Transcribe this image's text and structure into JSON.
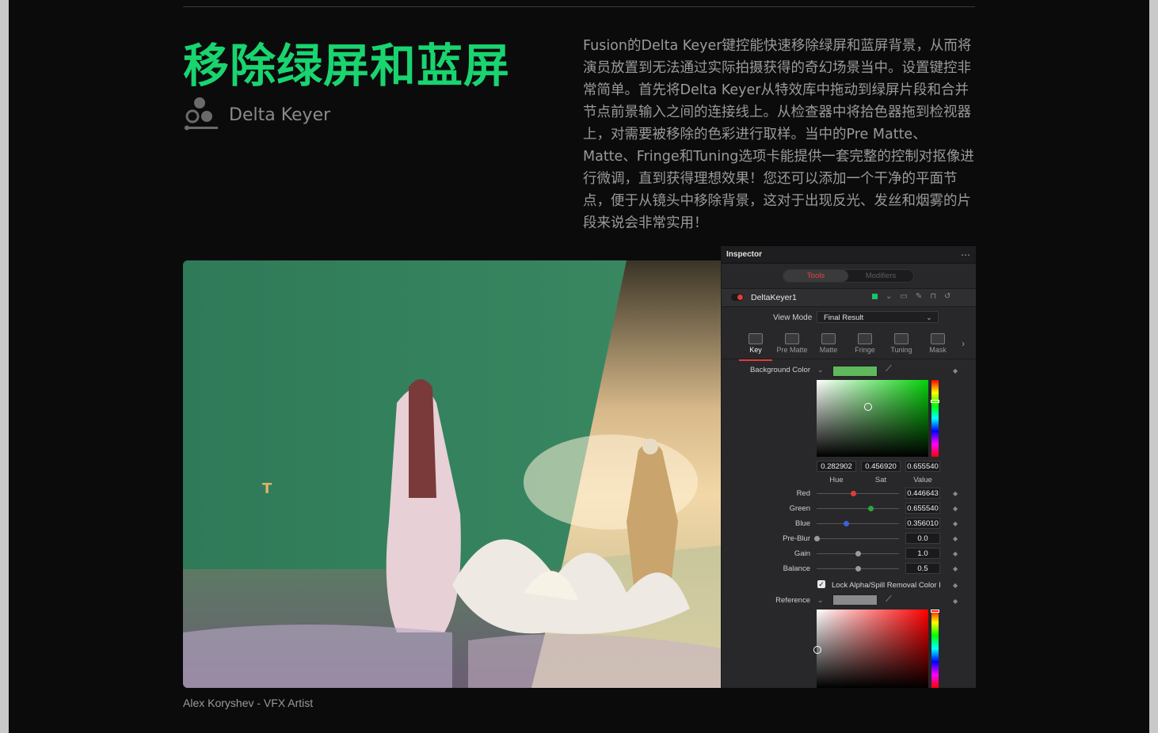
{
  "heading": "移除绿屏和蓝屏",
  "tool": {
    "name": "Delta Keyer",
    "icon": "delta-keyer-icon"
  },
  "description": "Fusion的Delta Keyer键控能快速移除绿屏和蓝屏背景，从而将演员放置到无法通过实际拍摄获得的奇幻场景当中。设置键控非常简单。首先将Delta Keyer从特效库中拖动到绿屏片段和合并节点前景输入之间的连接线上。从检查器中将拾色器拖到检视器上，对需要被移除的色彩进行取样。当中的Pre Matte、Matte、Fringe和Tuning选项卡能提供一套完整的控制对抠像进行微调，直到获得理想效果！您还可以添加一个干净的平面节点，便于从镜头中移除背景，这对于出现反光、发丝和烟雾的片段来说会非常实用！",
  "credit": "Alex Koryshev - VFX Artist",
  "colors": {
    "accent": "#19d46f",
    "keyer_bg_color": "#5fb85b",
    "tab_active": "#e23b3b"
  },
  "inspector": {
    "title": "Inspector",
    "more": "⋯",
    "segments": {
      "tools": "Tools",
      "modifiers": "Modifiers"
    },
    "node_name": "DeltaKeyer1",
    "view_mode": {
      "label": "View Mode",
      "value": "Final Result"
    },
    "tabs": [
      "Key",
      "Pre Matte",
      "Matte",
      "Fringe",
      "Tuning",
      "Mask"
    ],
    "active_tab": "Key",
    "background_color_label": "Background Color",
    "hsv": {
      "hue": "0.282902",
      "sat": "0.456920",
      "value": "0.655540"
    },
    "hsv_labels": {
      "hue": "Hue",
      "sat": "Sat",
      "value": "Value"
    },
    "params": [
      {
        "label": "Red",
        "value": "0.446643",
        "level": 0.446643,
        "color": "#e23b3b"
      },
      {
        "label": "Green",
        "value": "0.655540",
        "level": 0.65554,
        "color": "#2aa83a"
      },
      {
        "label": "Blue",
        "value": "0.356010",
        "level": 0.35601,
        "color": "#3a63d6"
      },
      {
        "label": "Pre-Blur",
        "value": "0.0",
        "level": 0.0,
        "color": "#9a9a9a"
      },
      {
        "label": "Gain",
        "value": "1.0",
        "level": 0.5,
        "color": "#9a9a9a"
      },
      {
        "label": "Balance",
        "value": "0.5",
        "level": 0.5,
        "color": "#9a9a9a"
      }
    ],
    "lock_label": "Lock Alpha/Spill Removal Color I",
    "reference_label": "Reference"
  },
  "photo_overlay_mark": "T"
}
